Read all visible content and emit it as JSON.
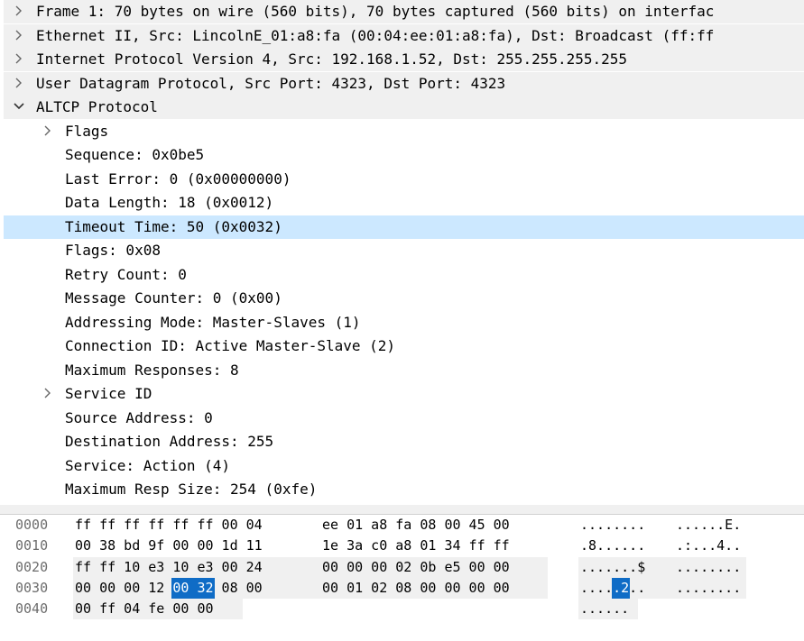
{
  "detail_tree": {
    "rows": [
      {
        "text": "Frame 1: 70 bytes on wire (560 bits), 70 bytes captured (560 bits) on interfac",
        "level": 0,
        "state": "collapsed"
      },
      {
        "text": "Ethernet II, Src: LincolnE_01:a8:fa (00:04:ee:01:a8:fa), Dst: Broadcast (ff:ff",
        "level": 0,
        "state": "collapsed"
      },
      {
        "text": "Internet Protocol Version 4, Src: 192.168.1.52, Dst: 255.255.255.255",
        "level": 0,
        "state": "collapsed"
      },
      {
        "text": "User Datagram Protocol, Src Port: 4323, Dst Port: 4323",
        "level": 0,
        "state": "collapsed"
      },
      {
        "text": "ALTCP Protocol",
        "level": 0,
        "state": "expanded"
      },
      {
        "text": "Flags",
        "level": 1,
        "state": "collapsed"
      },
      {
        "text": "Sequence: 0x0be5",
        "level": 1,
        "state": "leaf"
      },
      {
        "text": "Last Error: 0 (0x00000000)",
        "level": 1,
        "state": "leaf"
      },
      {
        "text": "Data Length: 18 (0x0012)",
        "level": 1,
        "state": "leaf"
      },
      {
        "text": "Timeout Time: 50 (0x0032)",
        "level": 1,
        "state": "leaf",
        "selected": true
      },
      {
        "text": "Flags: 0x08",
        "level": 1,
        "state": "leaf"
      },
      {
        "text": "Retry Count: 0",
        "level": 1,
        "state": "leaf"
      },
      {
        "text": "Message Counter: 0 (0x00)",
        "level": 1,
        "state": "leaf"
      },
      {
        "text": "Addressing Mode: Master-Slaves (1)",
        "level": 1,
        "state": "leaf"
      },
      {
        "text": "Connection ID: Active Master-Slave (2)",
        "level": 1,
        "state": "leaf"
      },
      {
        "text": "Maximum Responses: 8",
        "level": 1,
        "state": "leaf"
      },
      {
        "text": "Service ID",
        "level": 1,
        "state": "collapsed"
      },
      {
        "text": "Source Address: 0",
        "level": 1,
        "state": "leaf"
      },
      {
        "text": "Destination Address: 255",
        "level": 1,
        "state": "leaf"
      },
      {
        "text": "Service: Action (4)",
        "level": 1,
        "state": "leaf"
      },
      {
        "text": "Maximum Resp Size: 254 (0xfe)",
        "level": 1,
        "state": "leaf"
      }
    ]
  },
  "bytes_pane": {
    "rows": [
      {
        "offset": "0000",
        "hex1": "ff ff ff ff ff ff 00 04",
        "hex2": "ee 01 a8 fa 08 00 45 00",
        "ascii1": "........",
        "ascii2": "......E.",
        "shade": false
      },
      {
        "offset": "0010",
        "hex1": "00 38 bd 9f 00 00 1d 11",
        "hex2": "1e 3a c0 a8 01 34 ff ff",
        "ascii1": ".8......",
        "ascii2": ".:...4..",
        "shade": false
      },
      {
        "offset": "0020",
        "hex1": "ff ff 10 e3 10 e3 00 24",
        "hex2": "00 00 00 02 0b e5 00 00",
        "ascii1": ".......$",
        "ascii2": "........",
        "shade": true
      },
      {
        "offset": "0030",
        "hex1": "00 00 00 12 00 32 08 00",
        "hex2": "00 01 02 08 00 00 00 00",
        "ascii1": "....",
        "ascii_hl": ".2",
        "ascii1b": "..",
        "ascii2": "........",
        "shade": true,
        "hex_hl": "00 32",
        "hex_hl_start": 4,
        "hex_hl_len": 2
      },
      {
        "offset": "0040",
        "hex1": "00 ff 04 fe 00 00",
        "hex2": "",
        "ascii1": "......",
        "ascii2": "",
        "shade": true,
        "shade_partial": true
      }
    ]
  }
}
